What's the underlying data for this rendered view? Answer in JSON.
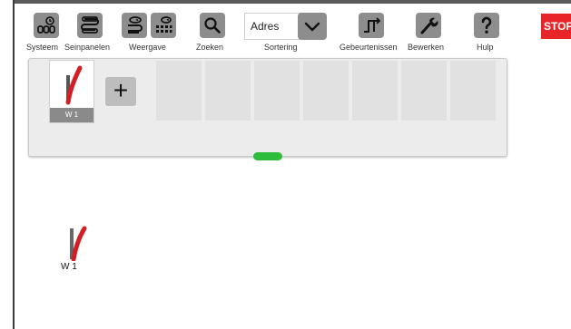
{
  "toolbar": {
    "system_label": "Systeem",
    "signal_panels_label": "Seinpanelen",
    "view_label": "Weergave",
    "search_label": "Zoeken",
    "sorting_label": "Sortering",
    "sorting_value": "Adres",
    "events_label": "Gebeurtenissen",
    "edit_label": "Bewerken",
    "help_label": "Hulp",
    "stop_label": "STOP"
  },
  "panel": {
    "tiles": [
      {
        "label": "W 1",
        "icon": "turnout-icon"
      }
    ],
    "add_icon": "plus-icon"
  },
  "layout": {
    "items": [
      {
        "label": "W 1",
        "icon": "turnout-icon"
      }
    ]
  },
  "colors": {
    "toolbar_button": "#8d8d8d",
    "stop": "#e8262a",
    "handle": "#2ebd3a",
    "turnout_red": "#d21f26"
  }
}
